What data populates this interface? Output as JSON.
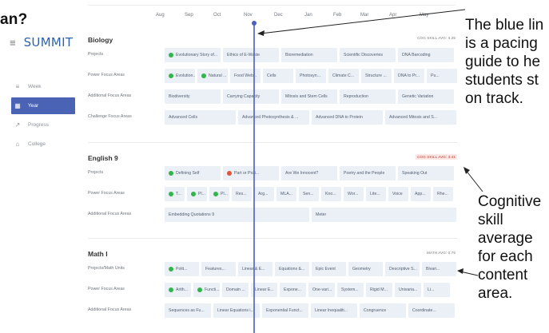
{
  "slide": {
    "title_fragment": "an?"
  },
  "sidebar": {
    "logo": "SUMMIT",
    "hamburger_icon": "menu-icon",
    "items": [
      {
        "label": "Week",
        "icon": "list-icon",
        "active": false
      },
      {
        "label": "Year",
        "icon": "grid-icon",
        "active": true
      },
      {
        "label": "Progress",
        "icon": "chart-icon",
        "active": false
      },
      {
        "label": "College",
        "icon": "graduation-cap-icon",
        "active": false
      }
    ]
  },
  "months": [
    "Aug",
    "Sep",
    "Oct",
    "Nov",
    "Dec",
    "Jan",
    "Feb",
    "Mar",
    "Apr",
    "May"
  ],
  "sections": [
    {
      "title": "Biology",
      "badge": "COG SKILL AVG: 4.25",
      "badge_color": "#777777",
      "rows": [
        {
          "label": "Projects",
          "tiles": [
            {
              "text": "Evolutionary Story of...",
              "dot": "green"
            },
            {
              "text": "Ethics of E-Waste"
            },
            {
              "text": "Bioremediation"
            },
            {
              "text": "Scientific Discoveries"
            },
            {
              "text": "DNA Barcoding"
            }
          ]
        },
        {
          "label": "Power Focus Areas",
          "tiles": [
            {
              "text": "Evolution...",
              "dot": "green"
            },
            {
              "text": "Natural ...",
              "dot": "green"
            },
            {
              "text": "Food Web..."
            },
            {
              "text": "Cells"
            },
            {
              "text": "Photosyn..."
            },
            {
              "text": "Climate C..."
            },
            {
              "text": "Structure ..."
            },
            {
              "text": "DNA to Pr..."
            },
            {
              "text": "Pu..."
            }
          ]
        },
        {
          "label": "Additional Focus Areas",
          "tiles": [
            {
              "text": "Biodiversity"
            },
            {
              "text": "Carrying Capacity"
            },
            {
              "text": "Mitosis and Stem Cells"
            },
            {
              "text": "Reproduction"
            },
            {
              "text": "Genetic Variation"
            }
          ]
        },
        {
          "label": "Challenge Focus Areas",
          "tiles": [
            {
              "text": "Advanced Cells"
            },
            {
              "text": "Advanced Photosynthesis & ..."
            },
            {
              "text": "Advanced DNA to Protein"
            },
            {
              "text": "Advanced Mitosis and S..."
            }
          ]
        }
      ]
    },
    {
      "title": "English 9",
      "badge": "COG SKILL AVG: 3.41",
      "badge_color": "#c0392b",
      "rows": [
        {
          "label": "Projects",
          "tiles": [
            {
              "text": "Defining Self",
              "dot": "green"
            },
            {
              "text": "Part or Picti...",
              "dot": "red"
            },
            {
              "text": "Are We Innocent?"
            },
            {
              "text": "Poetry and the People"
            },
            {
              "text": "Speaking Out"
            }
          ]
        },
        {
          "label": "Power Focus Areas",
          "tiles": [
            {
              "text": "T...",
              "dot": "green"
            },
            {
              "text": "Pl...",
              "dot": "green"
            },
            {
              "text": "Pl...",
              "dot": "green"
            },
            {
              "text": "Res..."
            },
            {
              "text": "Arg..."
            },
            {
              "text": "MLA..."
            },
            {
              "text": "Sen..."
            },
            {
              "text": "Kno..."
            },
            {
              "text": "Wor..."
            },
            {
              "text": "Lite..."
            },
            {
              "text": "Voice"
            },
            {
              "text": "App..."
            },
            {
              "text": "Rhe..."
            }
          ]
        },
        {
          "label": "Additional Focus Areas",
          "tiles": [
            {
              "text": "Embedding Quotations 9"
            },
            {
              "text": "Meter"
            }
          ]
        }
      ]
    },
    {
      "title": "Math I",
      "badge": "MATH AVG: 0.75",
      "badge_color": "#777777",
      "rows": [
        {
          "label": "Projects/Math Units",
          "tiles": [
            {
              "text": "Polit...",
              "dot": "green"
            },
            {
              "text": "Features..."
            },
            {
              "text": "Linear & E..."
            },
            {
              "text": "Equations &..."
            },
            {
              "text": "Epic Event"
            },
            {
              "text": "Geometry"
            },
            {
              "text": "Descriptive S..."
            },
            {
              "text": "Bivari..."
            }
          ]
        },
        {
          "label": "Power Focus Areas",
          "tiles": [
            {
              "text": "Arith...",
              "dot": "green"
            },
            {
              "text": "Functi...",
              "dot": "green"
            },
            {
              "text": "Domain ..."
            },
            {
              "text": "Linear E..."
            },
            {
              "text": "Expone..."
            },
            {
              "text": "One-vari..."
            },
            {
              "text": "System..."
            },
            {
              "text": "Rigid M..."
            },
            {
              "text": "Univaria..."
            },
            {
              "text": "Li..."
            }
          ]
        },
        {
          "label": "Additional Focus Areas",
          "tiles": [
            {
              "text": "Sequences as Fu..."
            },
            {
              "text": "Linear Equations i..."
            },
            {
              "text": "Exponential Funct..."
            },
            {
              "text": "Linear Inequaliti..."
            },
            {
              "text": "Congruence"
            },
            {
              "text": "Coordinate..."
            }
          ]
        }
      ]
    }
  ],
  "annotations": {
    "pacing_lines": [
      "The blue lin",
      "is a pacing",
      "guide to he",
      "students st",
      "on track."
    ],
    "skill_lines": [
      "Cognitive",
      "skill",
      "average",
      "for each",
      "content",
      "area."
    ]
  }
}
